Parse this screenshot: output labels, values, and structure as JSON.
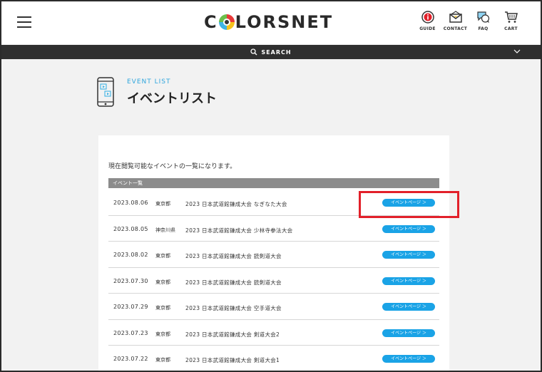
{
  "header": {
    "logo_text_left": "C",
    "logo_text_right": "LORSNET",
    "nav": [
      {
        "label": "GUIDE",
        "icon": "info-icon"
      },
      {
        "label": "CONTACT",
        "icon": "mail-icon"
      },
      {
        "label": "FAQ",
        "icon": "faq-chat-icon"
      },
      {
        "label": "CART",
        "icon": "cart-icon"
      }
    ]
  },
  "search": {
    "label": "SEARCH"
  },
  "page": {
    "eyebrow": "EVENT LIST",
    "title": "イベントリスト",
    "intro": "現在閲覧可能なイベントの一覧になります。",
    "list_header": "イベント一覧"
  },
  "events": [
    {
      "date": "2023.08.06",
      "pref": "東京都",
      "name": "2023 日本武道館鎌成大会 なぎなた大会",
      "button": "イベントページ ＞"
    },
    {
      "date": "2023.08.05",
      "pref": "神奈川県",
      "name": "2023 日本武道館鎌成大会 少林寺拳法大会",
      "button": "イベントページ ＞"
    },
    {
      "date": "2023.08.02",
      "pref": "東京都",
      "name": "2023 日本武道館鎌成大会 銃剣道大会",
      "button": "イベントページ ＞"
    },
    {
      "date": "2023.07.30",
      "pref": "東京都",
      "name": "2023 日本武道館鎌成大会 銃剣道大会",
      "button": "イベントページ ＞"
    },
    {
      "date": "2023.07.29",
      "pref": "東京都",
      "name": "2023 日本武道館鎌成大会 空手道大会",
      "button": "イベントページ ＞"
    },
    {
      "date": "2023.07.23",
      "pref": "東京都",
      "name": "2023 日本武道館鎌成大会 剣道大会2",
      "button": "イベントページ ＞"
    },
    {
      "date": "2023.07.22",
      "pref": "東京都",
      "name": "2023 日本武道館鎌成大会 剣道大会1",
      "button": "イベントページ ＞"
    }
  ],
  "colors": {
    "accent": "#1aa3e6",
    "highlight": "#e2202a",
    "searchbar": "#2f2f2f"
  }
}
